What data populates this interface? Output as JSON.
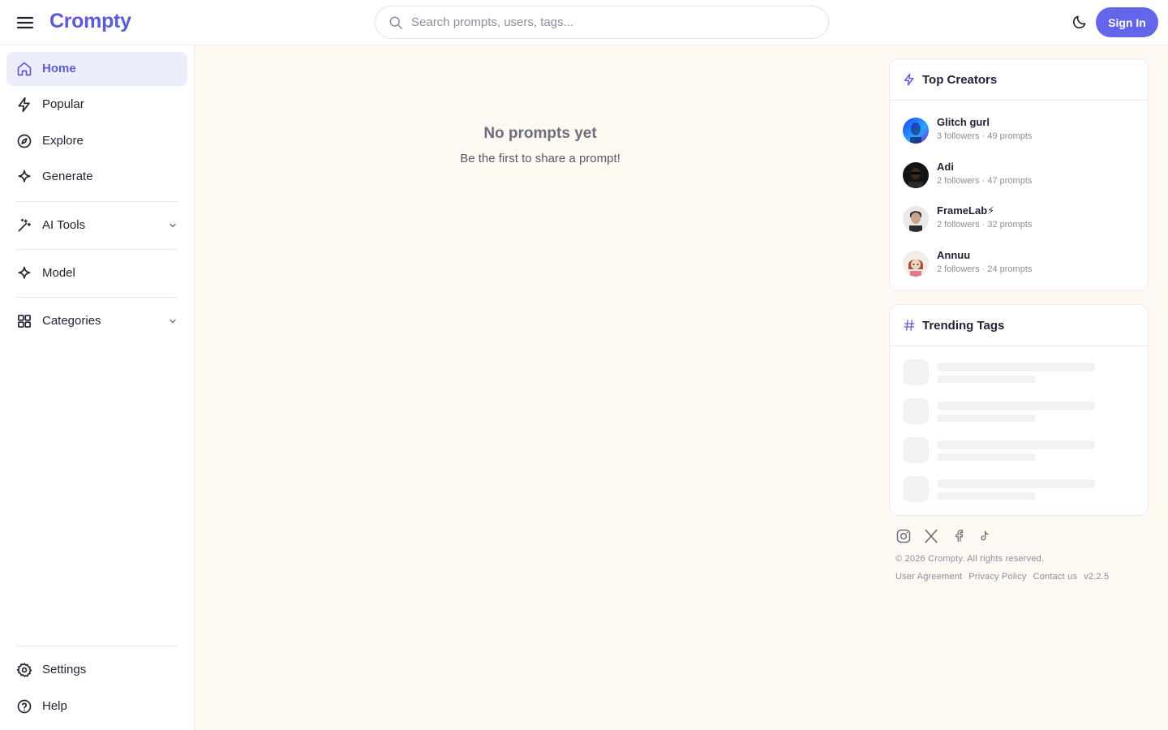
{
  "header": {
    "logo": "Crompty",
    "search_placeholder": "Search prompts, users, tags...",
    "signin_label": "Sign In",
    "accent": "#6466e9"
  },
  "sidebar": {
    "items": [
      {
        "label": "Home",
        "icon": "home-icon",
        "active": true
      },
      {
        "label": "Popular",
        "icon": "zap-icon"
      },
      {
        "label": "Explore",
        "icon": "compass-icon"
      },
      {
        "label": "Generate",
        "icon": "sparkle-icon"
      },
      {
        "label": "AI Tools",
        "icon": "wand-icon",
        "expandable": true
      },
      {
        "label": "Model",
        "icon": "sparkle-icon"
      },
      {
        "label": "Categories",
        "icon": "grid-icon",
        "expandable": true
      }
    ],
    "bottom": [
      {
        "label": "Settings",
        "icon": "gear-icon"
      },
      {
        "label": "Help",
        "icon": "help-circle-icon"
      }
    ]
  },
  "main": {
    "empty_title": "No prompts yet",
    "empty_subtitle": "Be the first to share a prompt!"
  },
  "top_creators": {
    "title": "Top Creators",
    "creators": [
      {
        "name": "Glitch gurl",
        "meta": "3 followers · 49 prompts"
      },
      {
        "name": "Adi",
        "meta": "2 followers · 47 prompts"
      },
      {
        "name": "FrameLab⚡",
        "meta": "2 followers · 32 prompts"
      },
      {
        "name": "Annuu",
        "meta": "2 followers · 24 prompts"
      }
    ]
  },
  "trending_tags": {
    "title": "Trending Tags"
  },
  "footer": {
    "copyright": "© 2026 Crompty. All rights reserved.",
    "links": [
      "User Agreement",
      "Privacy Policy",
      "Contact us"
    ],
    "version": "v2.2.5",
    "socials": [
      "instagram-icon",
      "x-icon",
      "facebook-icon",
      "tiktok-icon"
    ]
  }
}
